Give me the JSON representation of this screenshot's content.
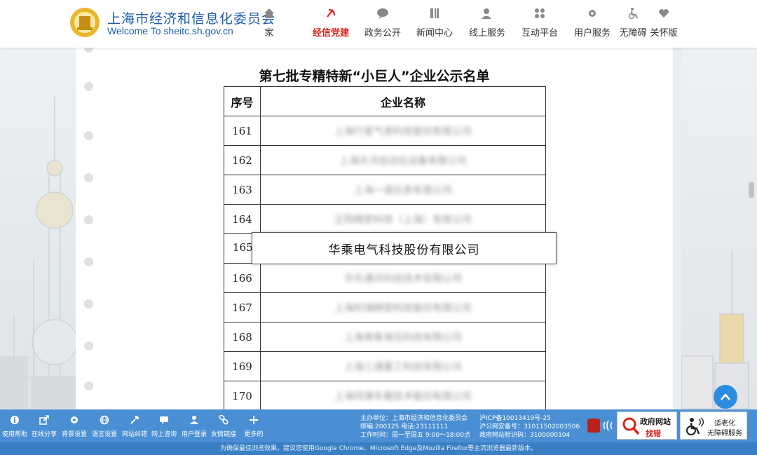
{
  "site": {
    "name_cn": "上海市经济和信息化委员会",
    "name_en": "Welcome To sheitc.sh.gov.cn"
  },
  "nav": [
    {
      "label": "家",
      "icon": "home-icon"
    },
    {
      "label": "经信党建",
      "icon": "party-emblem-icon",
      "active": true
    },
    {
      "label": "政务公开",
      "icon": "speech-bubble-icon"
    },
    {
      "label": "新闻中心",
      "icon": "news-icon"
    },
    {
      "label": "线上服务",
      "icon": "user-service-icon"
    },
    {
      "label": "互动平台",
      "icon": "interaction-icon"
    },
    {
      "label": "用户服务",
      "icon": "settings-user-icon"
    },
    {
      "label": "无障碍",
      "icon": "wheelchair-icon"
    },
    {
      "label": "关怀版",
      "icon": "heart-icon"
    }
  ],
  "article": {
    "title": "第七批专精特新“小巨人”企业公示名单",
    "col_no": "序号",
    "col_name": "企业名称",
    "rows": [
      {
        "no": "161",
        "name": "上海行星气源科技股份有限公司"
      },
      {
        "no": "162",
        "name": "上海天洋自动化设备有限公司"
      },
      {
        "no": "163",
        "name": "上海一诺仪表有限公司"
      },
      {
        "no": "164",
        "name": "正阳精密科技（上海）有限公司"
      },
      {
        "no": "165",
        "name": ""
      },
      {
        "no": "166",
        "name": "华乐通讯科技技术有限公司"
      },
      {
        "no": "167",
        "name": "上海科瑞精密科技股份有限公司"
      },
      {
        "no": "168",
        "name": "上海美客液压科技有限公司"
      },
      {
        "no": "169",
        "name": "上海三通重工科技有限公司"
      },
      {
        "no": "170",
        "name": "上海同港车载技术股份有限公司"
      }
    ],
    "highlight_no": "165",
    "highlight_name": "华乘电气科技股份有限公司"
  },
  "toolbar": [
    {
      "label": "使用帮助",
      "icon": "info-icon"
    },
    {
      "label": "在线分享",
      "icon": "share-icon"
    },
    {
      "label": "背景设置",
      "icon": "gear-icon"
    },
    {
      "label": "语言设置",
      "icon": "globe-icon"
    },
    {
      "label": "网站纠错",
      "icon": "wrench-icon"
    },
    {
      "label": "网上咨询",
      "icon": "chat-icon"
    },
    {
      "label": "用户登录",
      "icon": "user-icon"
    },
    {
      "label": "友情链接",
      "icon": "link-icon"
    },
    {
      "label": "更多的",
      "icon": "plus-icon"
    }
  ],
  "footer": {
    "sponsor": "主办单位：上海市经济和信息化委员会",
    "contact": "邮编:200125 电话:23111111",
    "hours": "工作时间：周一至周五 9:00～18:00点",
    "icp": "沪ICP备10013419号-25",
    "police": "沪公网安备号：31011502003506",
    "site_code": "政府网站标识码：3100000104",
    "gov_error_top": "政府网站",
    "gov_error_bottom": "找错",
    "elder_top": "适老化",
    "elder_bottom": "无障碍服务",
    "notice": "为确保最佳浏览效果，建议您使用Google Chrome、Microsoft Edge及Mozilla Firefox等主流浏览器最新版本。"
  },
  "colors": {
    "brand_blue": "#1d5ea8",
    "active_red": "#d3261d",
    "footer_blue": "#4a8fd3"
  }
}
